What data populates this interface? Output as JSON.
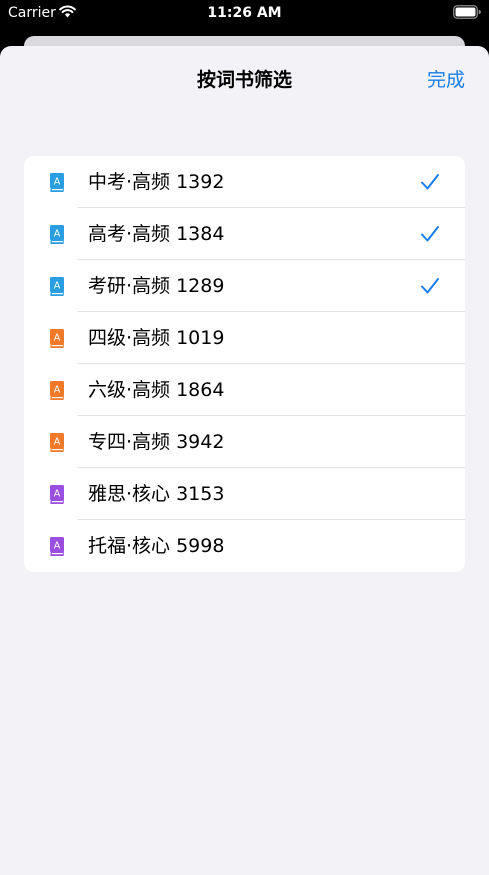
{
  "status_bar": {
    "carrier": "Carrier",
    "time": "11:26 AM"
  },
  "nav": {
    "title": "按词书筛选",
    "done_label": "完成"
  },
  "colors": {
    "accent": "#1a7ee8",
    "blue_book": "#2a9ee0",
    "orange_book": "#f07a2a",
    "purple_book": "#9b4fe0"
  },
  "word_books": [
    {
      "label": "中考·高频 1392",
      "icon": "book-icon",
      "color": "#2a9ee0",
      "selected": true
    },
    {
      "label": "高考·高频 1384",
      "icon": "book-icon",
      "color": "#2a9ee0",
      "selected": true
    },
    {
      "label": "考研·高频 1289",
      "icon": "book-icon",
      "color": "#2a9ee0",
      "selected": true
    },
    {
      "label": "四级·高频 1019",
      "icon": "book-icon",
      "color": "#f07a2a",
      "selected": false
    },
    {
      "label": "六级·高频 1864",
      "icon": "book-icon",
      "color": "#f07a2a",
      "selected": false
    },
    {
      "label": "专四·高频 3942",
      "icon": "book-icon",
      "color": "#f07a2a",
      "selected": false
    },
    {
      "label": "雅思·核心 3153",
      "icon": "book-icon",
      "color": "#9b4fe0",
      "selected": false
    },
    {
      "label": "托福·核心 5998",
      "icon": "book-icon",
      "color": "#9b4fe0",
      "selected": false
    }
  ]
}
